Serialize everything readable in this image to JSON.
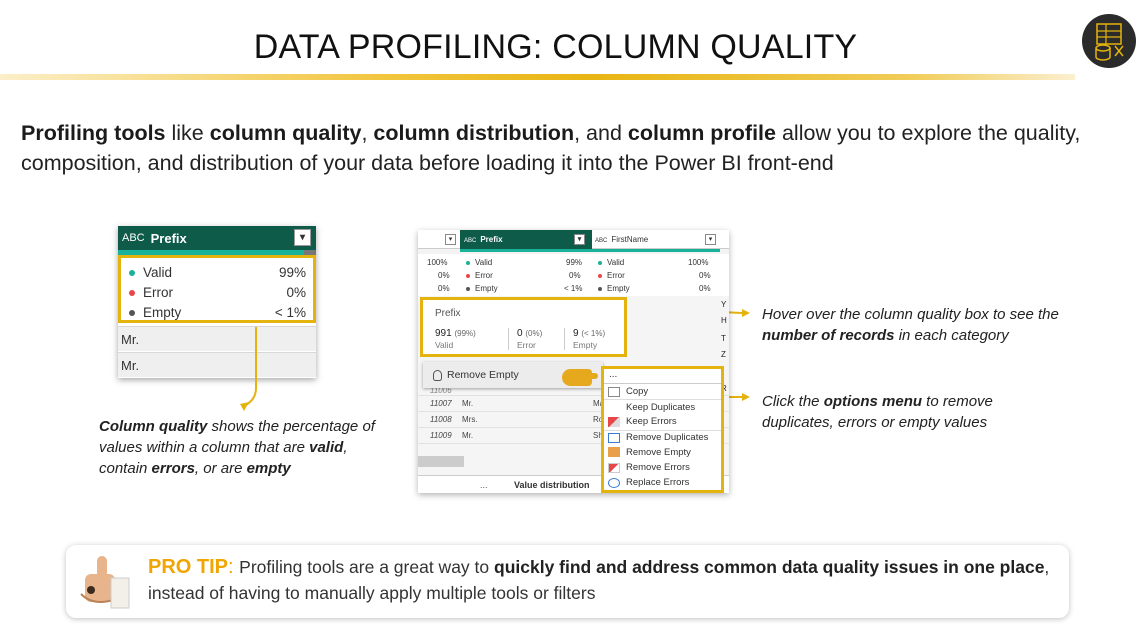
{
  "header": {
    "title": "DATA PROFILING: COLUMN QUALITY"
  },
  "intro": {
    "b1": "Profiling tools",
    "t1": " like ",
    "b2": "column quality",
    "t2": ", ",
    "b3": "column distribution",
    "t3": ", and ",
    "b4": "column profile",
    "t4": " allow you to explore the quality, composition, and distribution of your data before loading it into the Power BI front-end"
  },
  "left_box": {
    "column_type": "ABC",
    "column_name": "Prefix",
    "stats": [
      {
        "label": "Valid",
        "value": "99%",
        "color": "#1ab29a"
      },
      {
        "label": "Error",
        "value": "0%",
        "color": "#e8474a"
      },
      {
        "label": "Empty",
        "value": "< 1%",
        "color": "#555555"
      }
    ],
    "rows": [
      "Mr.",
      "Mr."
    ]
  },
  "left_caption": {
    "b1": "Column quality",
    "t1": " shows the percentage of values within a column that are ",
    "b2": "valid",
    "t2": ", contain ",
    "b3": "errors",
    "t3": ", or are ",
    "b4": "empty"
  },
  "mid": {
    "col_prefix": "Prefix",
    "col_firstname": "FirstName",
    "col_type": "ABC",
    "col1_stats": [
      "100%",
      "0%",
      "0%"
    ],
    "col2_labels": [
      "Valid",
      "Error",
      "Empty"
    ],
    "col2_values": [
      "99%",
      "0%",
      "< 1%"
    ],
    "col3_labels": [
      "Valid",
      "Error",
      "Empty"
    ],
    "col3_values": [
      "100%",
      "0%",
      "0%"
    ],
    "right_letters": [
      "Y",
      "H",
      "T",
      "Z",
      "R"
    ],
    "rows": [
      {
        "id": "11007",
        "prefix": "Mr.",
        "name": "Ma"
      },
      {
        "id": "11008",
        "prefix": "Mrs.",
        "name": "Ro"
      },
      {
        "id": "11009",
        "prefix": "Mr.",
        "name": "Sh"
      }
    ],
    "partial_row": "11006",
    "bottom_dots": "...",
    "bottom_label": "Value distribution"
  },
  "hover_popup": {
    "title": "Prefix",
    "cells": [
      {
        "count": "991",
        "pct": "(99%)",
        "label": "Valid"
      },
      {
        "count": "0",
        "pct": "(0%)",
        "label": "Error"
      },
      {
        "count": "9",
        "pct": "(< 1%)",
        "label": "Empty"
      }
    ]
  },
  "remove_empty": {
    "label": "Remove Empty",
    "icon": "lightbulb-icon"
  },
  "options_menu": {
    "trigger": "...",
    "items": [
      {
        "label": "Copy",
        "icon": "copy-icon"
      },
      {
        "label": "Keep Duplicates",
        "icon": "keep-duplicates-icon"
      },
      {
        "label": "Keep Errors",
        "icon": "keep-errors-icon"
      },
      {
        "label": "Remove Duplicates",
        "icon": "remove-duplicates-icon"
      },
      {
        "label": "Remove Empty",
        "icon": "remove-empty-icon"
      },
      {
        "label": "Remove Errors",
        "icon": "remove-errors-icon"
      },
      {
        "label": "Replace Errors",
        "icon": "replace-errors-icon"
      }
    ]
  },
  "right_caption_1": {
    "t1": "Hover over the column quality box to see the ",
    "b1": "number of records",
    "t2": " in each category"
  },
  "right_caption_2": {
    "t1": "Click the ",
    "b1": "options menu",
    "t2": " to remove duplicates, errors or empty values"
  },
  "pro_tip": {
    "label": "PRO TIP",
    "colon": ": ",
    "t1": "Profiling tools are a great way to ",
    "b1": "quickly find and address common data quality issues in one place",
    "t2": ", instead of having to manually apply multiple tools or filters"
  },
  "colors": {
    "accent_gold": "#e4b30d",
    "header_green": "#0e5b4a",
    "teal": "#1ab29a",
    "pro_tip_orange": "#f0a500"
  }
}
